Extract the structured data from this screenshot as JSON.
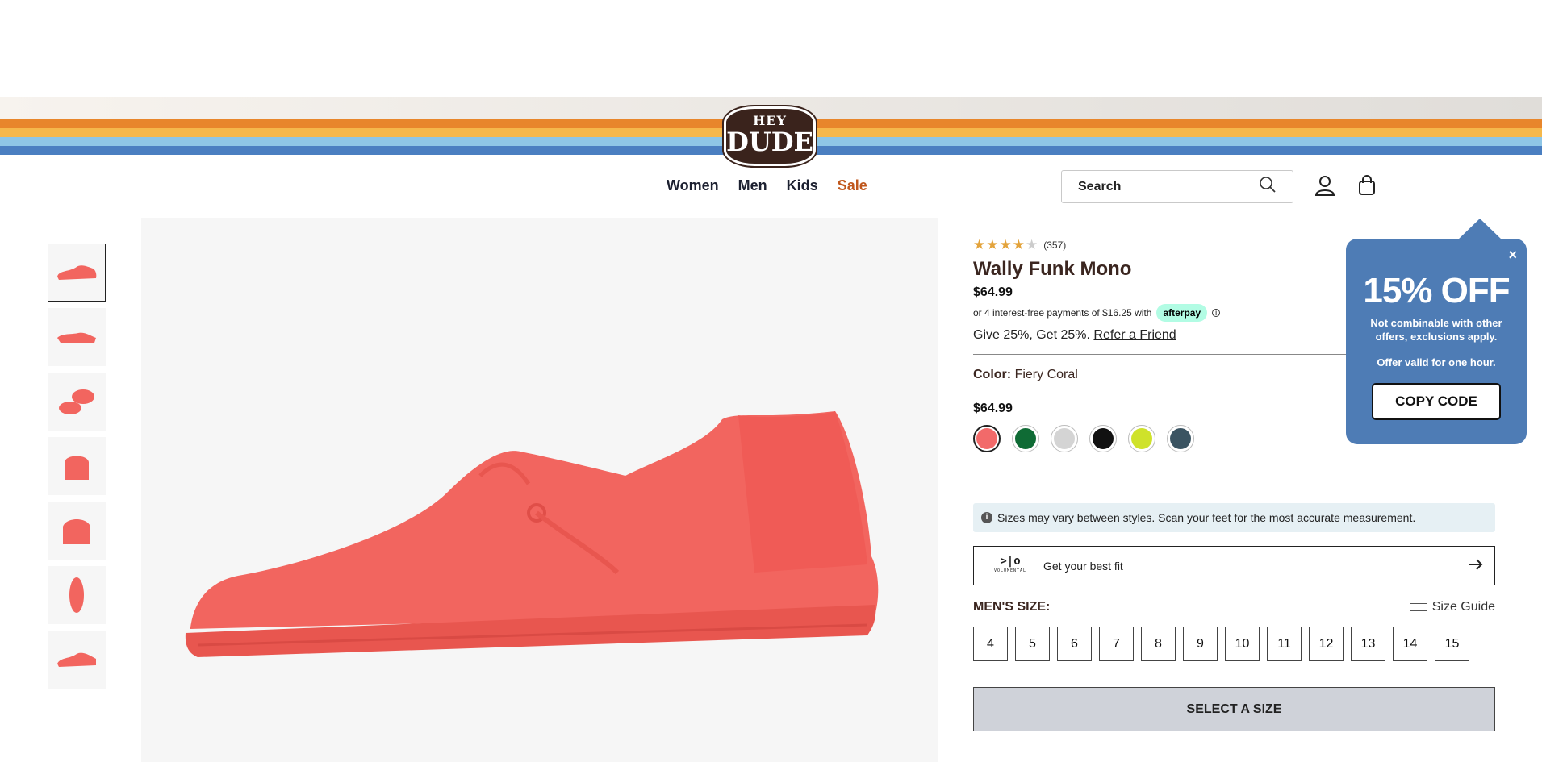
{
  "brand": {
    "logo_top": "HEY",
    "logo_bottom": "DUDE"
  },
  "header": {
    "stripe_colors": [
      "#e8862b",
      "#f5b84b",
      "#8ec6e6",
      "#4a7fc1"
    ],
    "nav": [
      {
        "label": "Women"
      },
      {
        "label": "Men"
      },
      {
        "label": "Kids"
      },
      {
        "label": "Sale"
      }
    ],
    "search": {
      "placeholder": "Search"
    }
  },
  "gallery": {
    "thumbnail_count": 7,
    "active_index": 0
  },
  "product": {
    "rating_stars": 4.5,
    "review_count": "(357)",
    "title": "Wally Funk Mono",
    "price": "$64.99",
    "afterpay_text": "or 4 interest-free payments of $16.25 with",
    "afterpay_brand": "afterpay",
    "referral_text": "Give 25%, Get 25%.",
    "referral_link": "Refer a Friend",
    "color_label": "Color:",
    "color_value": "Fiery Coral",
    "swatch_price": "$64.99",
    "swatches": [
      "#f26a6a",
      "#0f6b35",
      "#d4d4d4",
      "#111111",
      "#cfe22a",
      "#3b5462"
    ],
    "size_notice": "Sizes may vary between styles. Scan your feet for the most accurate measurement.",
    "fit_brand": ">|o",
    "fit_brand_sub": "VOLUMENTAL",
    "fit_label": "Get your best fit",
    "size_label": "MEN'S SIZE:",
    "size_guide": "Size Guide",
    "sizes": [
      "4",
      "5",
      "6",
      "7",
      "8",
      "9",
      "10",
      "11",
      "12",
      "13",
      "14",
      "15"
    ],
    "cta": "SELECT A SIZE"
  },
  "promo": {
    "close": "×",
    "headline": "15% OFF",
    "line1": "Not combinable with other offers, exclusions apply.",
    "line2": "Offer valid for one hour.",
    "button": "COPY CODE"
  },
  "colors": {
    "shoe": "#f2655f",
    "accent": "#4e7cb5",
    "sale": "#c0571c"
  }
}
